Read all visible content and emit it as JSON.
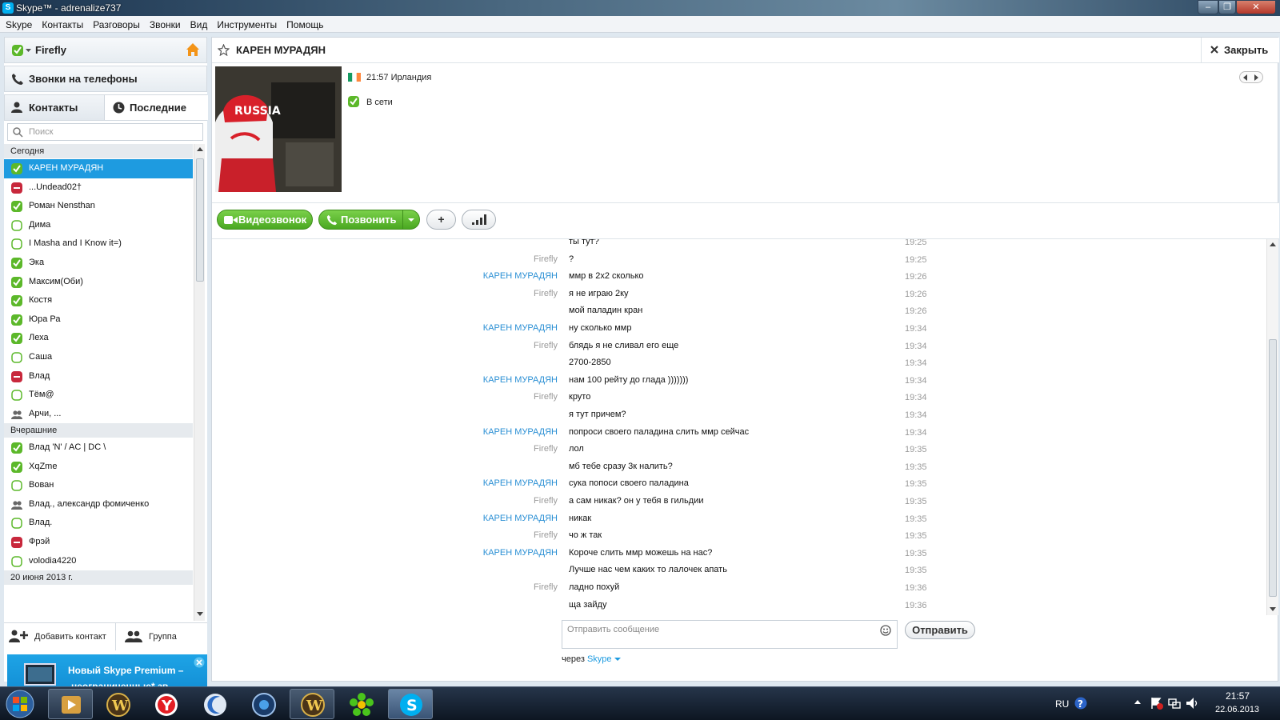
{
  "window": {
    "title": "Skype™ - adrenalize737",
    "app_icon_letter": "S",
    "min": "–",
    "max": "❐",
    "close": "✕"
  },
  "menu": [
    "Skype",
    "Контакты",
    "Разговоры",
    "Звонки",
    "Вид",
    "Инструменты",
    "Помощь"
  ],
  "profile": {
    "name": "Firefly"
  },
  "phone_calls": {
    "label": "Звонки на телефоны"
  },
  "tabs": {
    "contacts": "Контакты",
    "recent": "Последние"
  },
  "search": {
    "placeholder": "Поиск"
  },
  "groups": {
    "today": "Сегодня",
    "yesterday": "Вчерашние",
    "date": "20 июня 2013 г."
  },
  "contacts_today": [
    {
      "name": "КАРЕН МУРАДЯН",
      "status": "online"
    },
    {
      "name": "...Undead02†",
      "status": "offline"
    },
    {
      "name": "Роман Nensthan",
      "status": "online"
    },
    {
      "name": "Дима",
      "status": "away"
    },
    {
      "name": "I Masha and I Know it=)",
      "status": "away"
    },
    {
      "name": "Эка",
      "status": "online"
    },
    {
      "name": "Максим(Оби)",
      "status": "online"
    },
    {
      "name": "Костя",
      "status": "online"
    },
    {
      "name": "Юра Ра",
      "status": "online"
    },
    {
      "name": "Леха",
      "status": "online"
    },
    {
      "name": "Саша",
      "status": "away"
    },
    {
      "name": "Влад",
      "status": "offline"
    },
    {
      "name": "Тём@",
      "status": "away"
    },
    {
      "name": "Арчи, ...",
      "status": "group"
    }
  ],
  "contacts_yesterday": [
    {
      "name": "Влад 'N' / AC | DC \\",
      "status": "online"
    },
    {
      "name": "XqZme",
      "status": "online"
    },
    {
      "name": "Вован",
      "status": "away"
    },
    {
      "name": "Влад., александр фомиченко",
      "status": "group"
    },
    {
      "name": "Влад.",
      "status": "away"
    },
    {
      "name": "Фрэй",
      "status": "offline"
    },
    {
      "name": "volodia4220",
      "status": "away"
    }
  ],
  "bottom": {
    "add_contact": "Добавить контакт",
    "group": "Группа"
  },
  "promo": {
    "line1": "Новый Skype Premium –",
    "line2": "неограниченные* зв..."
  },
  "chat": {
    "contact_name": "КАРЕН МУРАДЯН",
    "close_label": "Закрыть",
    "local_time": "21:57 Ирландия",
    "status": "В сети"
  },
  "buttons": {
    "video": "Видеозвонок",
    "call": "Позвонить",
    "add": "+",
    "send": "Отправить"
  },
  "messages": [
    {
      "author": "",
      "text": "ты тут?",
      "time": "19:25"
    },
    {
      "author": "Firefly",
      "text": "?",
      "time": "19:25"
    },
    {
      "author": "КАРЕН МУРАДЯН",
      "text": "ммр в 2х2 сколько",
      "time": "19:26"
    },
    {
      "author": "Firefly",
      "text": "я не играю 2ку",
      "time": "19:26"
    },
    {
      "author": "",
      "text": "мой паладин кран",
      "time": "19:26"
    },
    {
      "author": "КАРЕН МУРАДЯН",
      "text": "ну сколько ммр",
      "time": "19:34"
    },
    {
      "author": "Firefly",
      "text": "блядь я не сливал его еще",
      "time": "19:34"
    },
    {
      "author": "",
      "text": "2700-2850",
      "time": "19:34"
    },
    {
      "author": "КАРЕН МУРАДЯН",
      "text": "нам 100 рейту до глада )))))))",
      "time": "19:34"
    },
    {
      "author": "Firefly",
      "text": "круто",
      "time": "19:34"
    },
    {
      "author": "",
      "text": "я тут причем?",
      "time": "19:34"
    },
    {
      "author": "КАРЕН МУРАДЯН",
      "text": "попроси своего паладина слить ммр сейчас",
      "time": "19:34"
    },
    {
      "author": "Firefly",
      "text": "лол",
      "time": "19:35"
    },
    {
      "author": "",
      "text": "мб тебе сразу 3к налить?",
      "time": "19:35"
    },
    {
      "author": "КАРЕН МУРАДЯН",
      "text": "сука попоси своего паладина",
      "time": "19:35"
    },
    {
      "author": "Firefly",
      "text": "а сам никак? он у тебя в гильдии",
      "time": "19:35"
    },
    {
      "author": "КАРЕН МУРАДЯН",
      "text": "никак",
      "time": "19:35"
    },
    {
      "author": "Firefly",
      "text": "чо ж так",
      "time": "19:35"
    },
    {
      "author": "КАРЕН МУРАДЯН",
      "text": "Короче слить ммр можешь на нас?",
      "time": "19:35"
    },
    {
      "author": "",
      "text": "Лучше нас чем каких то лалочек апать",
      "time": "19:35"
    },
    {
      "author": "Firefly",
      "text": "ладно похуй",
      "time": "19:36"
    },
    {
      "author": "",
      "text": "ща зайду",
      "time": "19:36"
    }
  ],
  "compose": {
    "placeholder": "Отправить сообщение",
    "via_prefix": "через",
    "via_service": "Skype"
  },
  "taskbar": {
    "lang": "RU",
    "time": "21:57",
    "date": "22.06.2013"
  },
  "colors": {
    "accent": "#1e9be0",
    "online": "#5cb82a",
    "offline": "#c8283c",
    "call_green": "#5ab52a"
  }
}
